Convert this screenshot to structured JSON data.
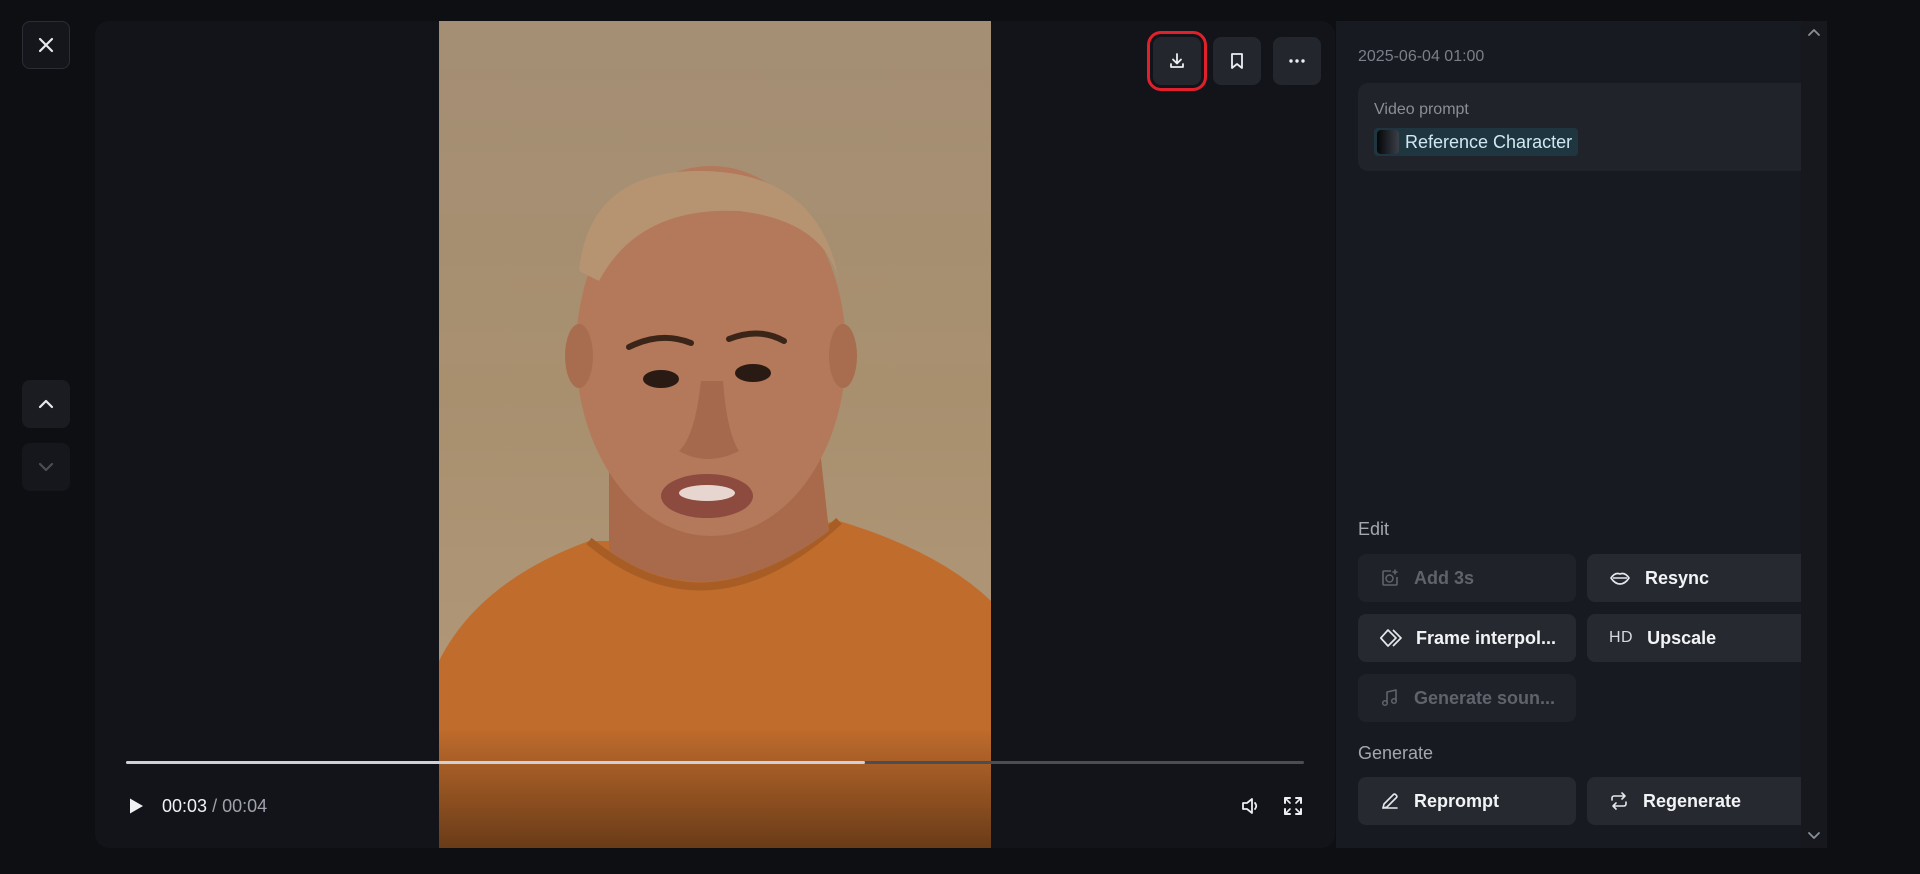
{
  "window": {
    "close_icon": "close-icon"
  },
  "nav": {
    "up_icon": "chevron-up-icon",
    "down_icon": "chevron-down-icon"
  },
  "player": {
    "actions": [
      {
        "name": "download",
        "icon": "download-icon",
        "highlighted": true
      },
      {
        "name": "bookmark",
        "icon": "bookmark-icon"
      },
      {
        "name": "more",
        "icon": "more-horizontal-icon"
      }
    ],
    "progress_fraction": 0.627,
    "current_time": "00:03",
    "separator": "/",
    "duration": "00:04"
  },
  "details": {
    "timestamp": "2025-06-04 01:00",
    "prompt_label": "Video prompt",
    "prompt_chip": "Reference Character"
  },
  "edit": {
    "label": "Edit",
    "add3s": "Add 3s",
    "resync": "Resync",
    "frame_interpolation": "Frame interpol...",
    "upscale_prefix": "HD",
    "upscale": "Upscale",
    "generate_sound": "Generate soun..."
  },
  "generate": {
    "label": "Generate",
    "reprompt": "Reprompt",
    "regenerate": "Regenerate"
  },
  "colors": {
    "highlight": "#e0202a",
    "chip_bg": "#1f3640",
    "panel_bg": "#181a21"
  }
}
